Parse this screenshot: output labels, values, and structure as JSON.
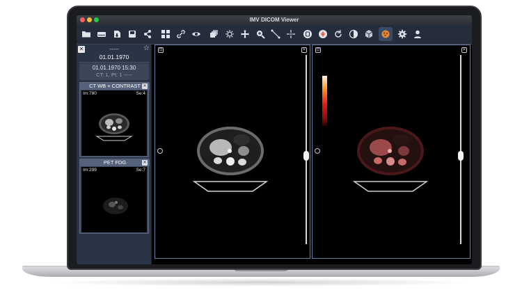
{
  "window": {
    "title": "IMV DICOM Viewer"
  },
  "toolbar": {
    "buttons": [
      {
        "name": "open-folder-icon"
      },
      {
        "name": "storage-icon"
      },
      {
        "name": "import-icon"
      },
      {
        "name": "export-icon"
      },
      {
        "name": "share-icon"
      },
      {
        "name": "layout-grid-icon"
      },
      {
        "name": "link-icon"
      },
      {
        "name": "eye-icon"
      },
      {
        "name": "stack-icon"
      },
      {
        "name": "brightness-icon"
      },
      {
        "name": "pan-icon"
      },
      {
        "name": "zoom-icon"
      },
      {
        "name": "measure-icon"
      },
      {
        "name": "crosshair-icon"
      },
      {
        "name": "annotation-icon"
      },
      {
        "name": "target-icon"
      },
      {
        "name": "rotate-icon"
      },
      {
        "name": "invert-icon"
      },
      {
        "name": "cube-icon"
      },
      {
        "name": "colormap-icon"
      },
      {
        "name": "settings-icon"
      },
      {
        "name": "user-icon"
      }
    ]
  },
  "sidebar": {
    "patient_name": "-----",
    "patient_date": "01.01.1970",
    "study": {
      "datetime": "01.01.1970 15:30",
      "info": "CT: 1, Pt: 1 -----"
    },
    "series": [
      {
        "title": "CT WB + CONTRAST",
        "images": "Im:780",
        "series_no": "Se:4"
      },
      {
        "title": "PET FDG",
        "images": "Im:299",
        "series_no": "Se:7"
      }
    ]
  },
  "colors": {
    "accent": "#6b7fa8",
    "toolbar_bg": "#252d3c",
    "sidebar_bg": "#2a3445",
    "colormap_icon": "#e58a3a"
  }
}
